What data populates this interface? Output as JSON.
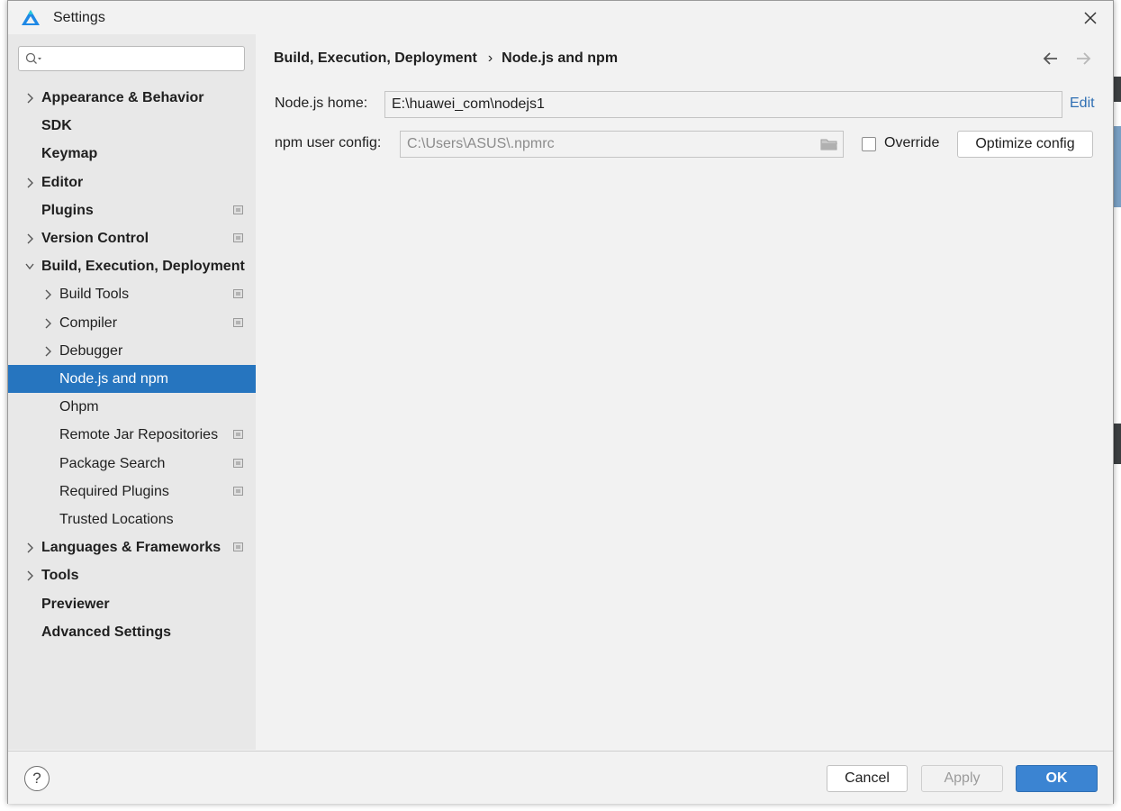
{
  "window": {
    "title": "Settings"
  },
  "sidebar": {
    "search": {
      "placeholder": ""
    },
    "items": [
      {
        "label": "Appearance & Behavior",
        "level": 0,
        "expandable": true
      },
      {
        "label": "SDK",
        "level": 0,
        "expandable": false
      },
      {
        "label": "Keymap",
        "level": 0,
        "expandable": false
      },
      {
        "label": "Editor",
        "level": 0,
        "expandable": true
      },
      {
        "label": "Plugins",
        "level": 0,
        "expandable": false,
        "project_icon": true
      },
      {
        "label": "Version Control",
        "level": 0,
        "expandable": true,
        "project_icon": true
      },
      {
        "label": "Build, Execution, Deployment",
        "level": 0,
        "expandable": true,
        "expanded": true
      },
      {
        "label": "Build Tools",
        "level": 1,
        "expandable": true,
        "project_icon": true
      },
      {
        "label": "Compiler",
        "level": 1,
        "expandable": true,
        "project_icon": true
      },
      {
        "label": "Debugger",
        "level": 1,
        "expandable": true
      },
      {
        "label": "Node.js and npm",
        "level": 1,
        "expandable": false,
        "selected": true
      },
      {
        "label": "Ohpm",
        "level": 1,
        "expandable": false
      },
      {
        "label": "Remote Jar Repositories",
        "level": 1,
        "expandable": false,
        "project_icon": true
      },
      {
        "label": "Package Search",
        "level": 1,
        "expandable": false,
        "project_icon": true
      },
      {
        "label": "Required Plugins",
        "level": 1,
        "expandable": false,
        "project_icon": true
      },
      {
        "label": "Trusted Locations",
        "level": 1,
        "expandable": false
      },
      {
        "label": "Languages & Frameworks",
        "level": 0,
        "expandable": true,
        "project_icon": true
      },
      {
        "label": "Tools",
        "level": 0,
        "expandable": true
      },
      {
        "label": "Previewer",
        "level": 0,
        "expandable": false
      },
      {
        "label": "Advanced Settings",
        "level": 0,
        "expandable": false
      }
    ]
  },
  "content": {
    "breadcrumb": [
      "Build, Execution, Deployment",
      "Node.js and npm"
    ],
    "nodejs_home": {
      "label": "Node.js home:",
      "value": "E:\\huawei_com\\nodejs1",
      "edit_label": "Edit"
    },
    "npm_config": {
      "label": "npm user config:",
      "value": "C:\\Users\\ASUS\\.npmrc"
    },
    "override": {
      "label": "Override",
      "checked": false
    },
    "optimize_label": "Optimize config"
  },
  "footer": {
    "cancel_label": "Cancel",
    "apply_label": "Apply",
    "ok_label": "OK",
    "help_label": "?"
  },
  "colors": {
    "selection": "#2675bf",
    "ok_button": "#3b84d2",
    "link": "#2f6fb3"
  }
}
